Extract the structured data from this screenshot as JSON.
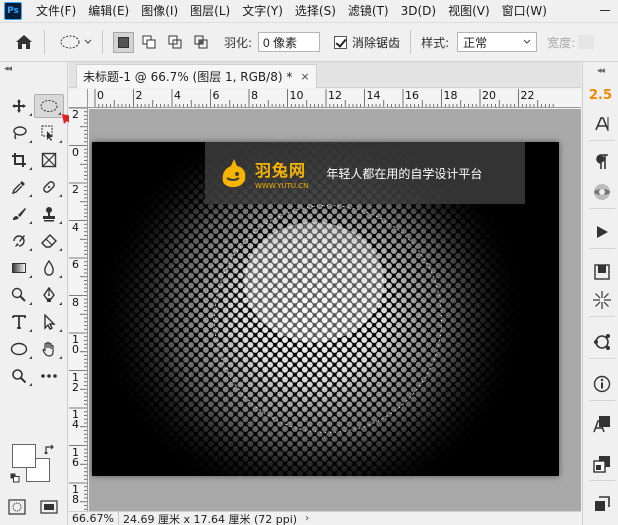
{
  "app": {
    "logo": "Ps"
  },
  "menu": [
    "文件(F)",
    "编辑(E)",
    "图像(I)",
    "图层(L)",
    "文字(Y)",
    "选择(S)",
    "滤镜(T)",
    "3D(D)",
    "视图(V)",
    "窗口(W)"
  ],
  "options": {
    "feather_label": "羽化:",
    "feather_value": "0 像素",
    "antialias_label": "消除锯齿",
    "antialias_checked": true,
    "style_label": "样式:",
    "style_value": "正常",
    "width_label": "宽度:"
  },
  "document": {
    "tab_title": "未标题-1 @ 66.7% (图层 1, RGB/8) *",
    "close_glyph": "×"
  },
  "rulers": {
    "h_ticks": [
      "0",
      "2",
      "4",
      "6",
      "8",
      "10",
      "12",
      "14",
      "16",
      "18",
      "20",
      "22"
    ],
    "v_ticks": [
      "2",
      "0",
      "2",
      "4",
      "6",
      "8",
      "10",
      "12",
      "14",
      "16",
      "18"
    ]
  },
  "watermark": {
    "brand": "羽兔网",
    "url": "WWW.YUTU.CN",
    "slogan": "年轻人都在用的自学设计平台"
  },
  "status": {
    "zoom": "66.67%",
    "doc_info": "24.69 厘米 x 17.64 厘米 (72 ppi)",
    "arrow": "›"
  },
  "right_panel": {
    "version_label": "2.5"
  },
  "colors": {
    "accent": "#f08a00",
    "selection_arrow": "#e02020",
    "brand_yellow": "#f6b400"
  },
  "tools": [
    [
      "move-tool-icon",
      "elliptical-marquee-tool-icon"
    ],
    [
      "lasso-tool-icon",
      "object-selection-tool-icon"
    ],
    [
      "crop-tool-icon",
      "frame-tool-icon"
    ],
    [
      "eyedropper-tool-icon",
      "healing-brush-tool-icon"
    ],
    [
      "brush-tool-icon",
      "clone-stamp-tool-icon"
    ],
    [
      "history-brush-tool-icon",
      "eraser-tool-icon"
    ],
    [
      "gradient-tool-icon",
      "blur-tool-icon"
    ],
    [
      "dodge-tool-icon",
      "pen-tool-icon"
    ],
    [
      "type-tool-icon",
      "path-selection-tool-icon"
    ],
    [
      "ellipse-shape-tool-icon",
      "hand-tool-icon"
    ],
    [
      "zoom-tool-icon",
      "more-tools-icon"
    ]
  ]
}
